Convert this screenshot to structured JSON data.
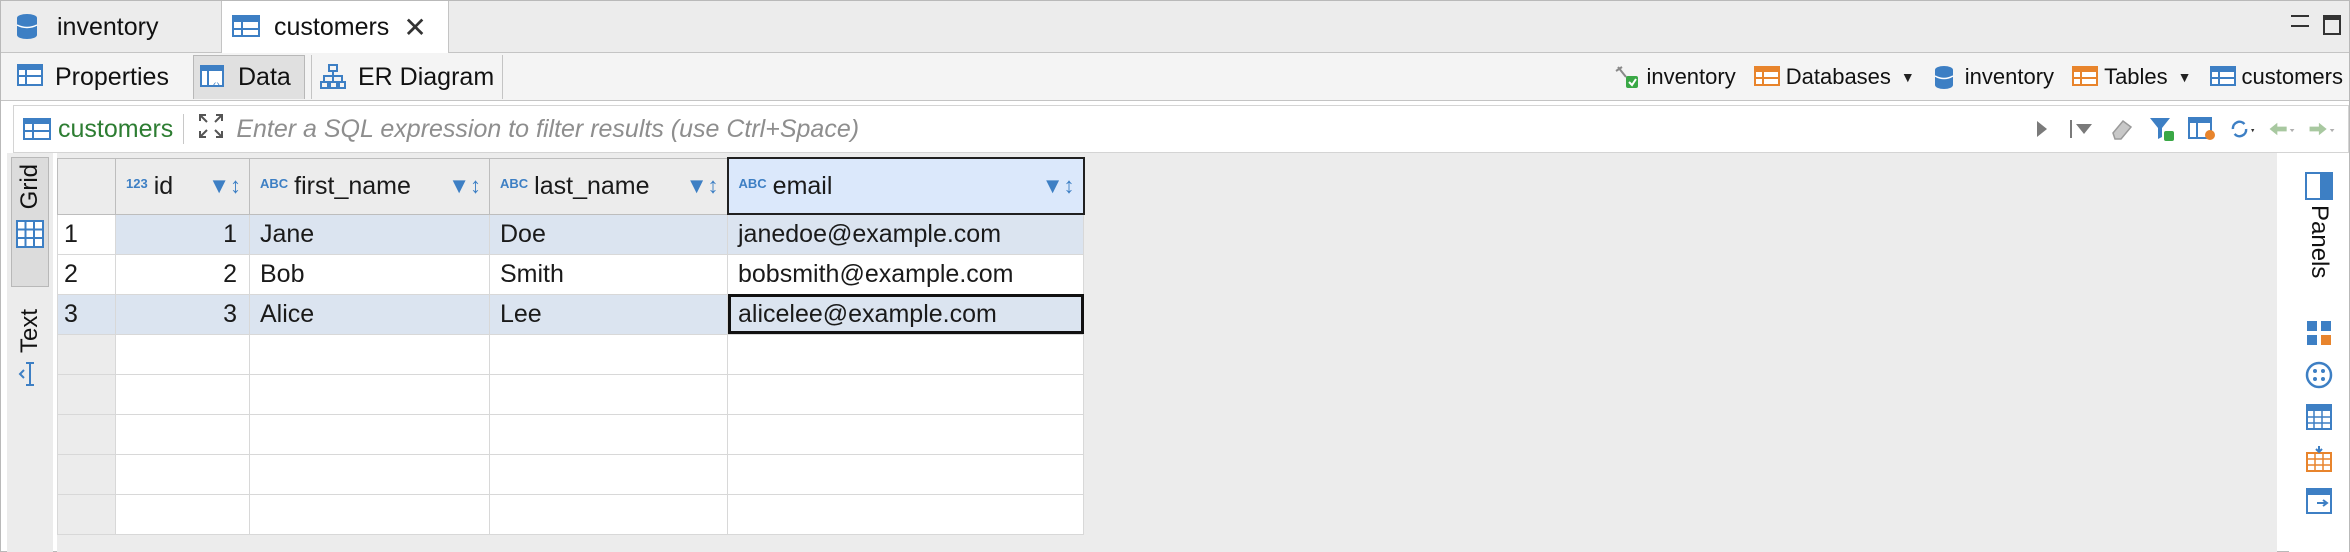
{
  "editor_tabs": [
    {
      "label": "inventory",
      "icon": "database-icon",
      "closable": false
    },
    {
      "label": "customers",
      "icon": "table-icon",
      "closable": true,
      "close_glyph": "✕"
    }
  ],
  "sub_tabs": [
    {
      "label": "Properties",
      "icon": "properties-icon"
    },
    {
      "label": "Data",
      "icon": "data-grid-icon",
      "active": true
    },
    {
      "label": "ER Diagram",
      "icon": "er-diagram-icon"
    }
  ],
  "breadcrumbs": [
    {
      "label": "inventory",
      "icon": "connection-icon",
      "dropdown": false
    },
    {
      "label": "Databases",
      "icon": "databases-folder-icon",
      "dropdown": true
    },
    {
      "label": "inventory",
      "icon": "database-icon",
      "dropdown": false
    },
    {
      "label": "Tables",
      "icon": "tables-folder-icon",
      "dropdown": true
    },
    {
      "label": "customers",
      "icon": "table-icon",
      "dropdown": false
    }
  ],
  "filter": {
    "entity": "customers",
    "placeholder": "Enter a SQL expression to filter results (use Ctrl+Space)"
  },
  "side_tabs": {
    "grid": "Grid",
    "text": "Text",
    "panels": "Panels"
  },
  "grid": {
    "columns": [
      {
        "name": "id",
        "type_badge": "123"
      },
      {
        "name": "first_name",
        "type_badge": "ABC"
      },
      {
        "name": "last_name",
        "type_badge": "ABC"
      },
      {
        "name": "email",
        "type_badge": "ABC"
      }
    ],
    "rows": [
      {
        "num": "1",
        "id": "1",
        "first_name": "Jane",
        "last_name": "Doe",
        "email": "janedoe@example.com"
      },
      {
        "num": "2",
        "id": "2",
        "first_name": "Bob",
        "last_name": "Smith",
        "email": "bobsmith@example.com"
      },
      {
        "num": "3",
        "id": "3",
        "first_name": "Alice",
        "last_name": "Lee",
        "email": "alicelee@example.com"
      }
    ],
    "selected_row": "3",
    "selected_column": "email"
  },
  "colors": {
    "accent_blue": "#3d7fc4",
    "folder_orange": "#e8842c",
    "entity_green": "#2d7d32",
    "selection": "#dbe4f0"
  }
}
